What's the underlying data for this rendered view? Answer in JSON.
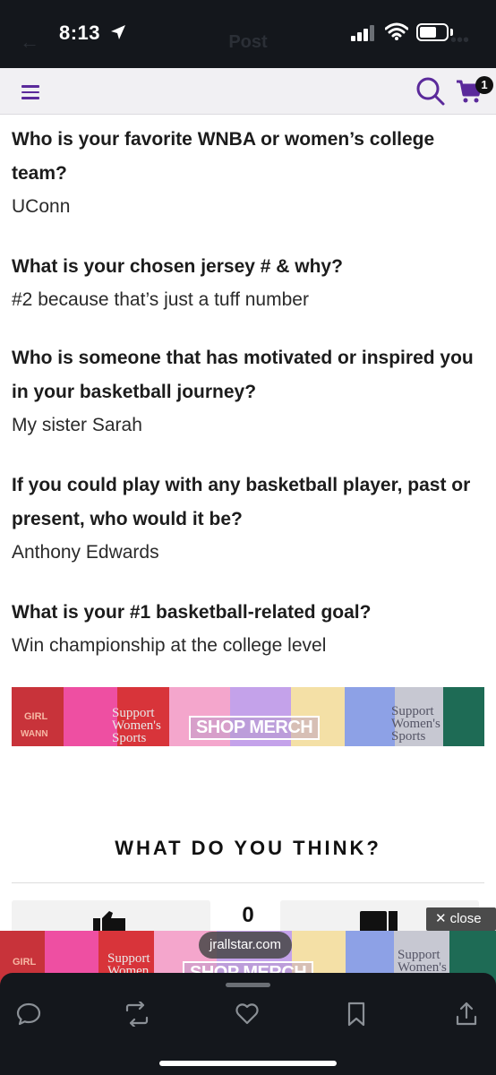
{
  "status_bar": {
    "time": "8:13"
  },
  "post_nav": {
    "back": "←",
    "title": "Post",
    "more": "•••"
  },
  "site_header": {
    "cart_count": "1",
    "accent_color": "#5b2a9b",
    "icons": [
      "hamburger-menu-icon",
      "search-icon",
      "cart-icon"
    ]
  },
  "article": {
    "qa": [
      {
        "question": "Who is your favorite WNBA or women’s college team?",
        "answer": "UConn"
      },
      {
        "question": "What is your chosen jersey # & why?",
        "answer": "#2 because that’s just a tuff number"
      },
      {
        "question": "Who is someone that has motivated or inspired you in your basketball journey?",
        "answer": "My sister Sarah"
      },
      {
        "question": "If you could play with any basketball player, past or present, who would it be?",
        "answer": "Anthony Edwards"
      },
      {
        "question": "What is your #1 basketball-related goal?",
        "answer": "Win championship at the college level"
      }
    ]
  },
  "merch_banner": {
    "cta": "SHOP MERCH",
    "text_1": "Support Women's Sports",
    "text_2": "Support Women's Sports",
    "text_3": "GIRL",
    "text_4": "WANN"
  },
  "reactions": {
    "heading": "WHAT DO YOU THINK?",
    "count": "0"
  },
  "ad": {
    "close_label": "close",
    "domain": "jrallstar.com",
    "cta": "SHOP MERCH",
    "text_1": "Support Women",
    "text_2": "Support Women's",
    "text_3": "GIRL"
  },
  "bottom_bar": {
    "icons": [
      "reply-icon",
      "repost-icon",
      "like-icon",
      "bookmark-icon",
      "share-icon"
    ]
  }
}
